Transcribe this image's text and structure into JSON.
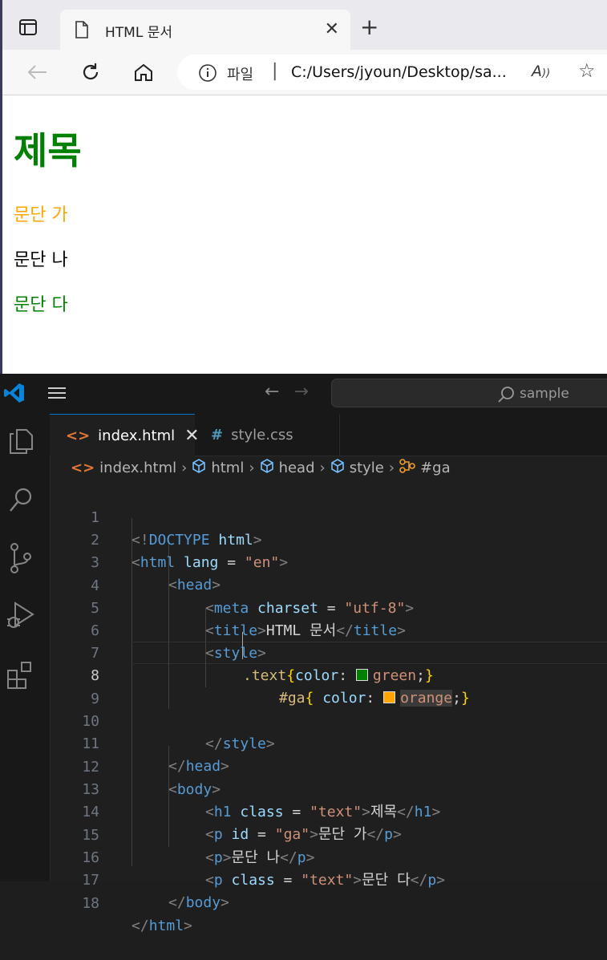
{
  "browser": {
    "tab_title": "HTML 문서",
    "address_label": "파일",
    "address_separator": "|",
    "address_url": "C:/Users/jyoun/Desktop/sa...",
    "read_aloud": "À",
    "page": {
      "h1": "제목",
      "p1": "문단 가",
      "p2": "문단 나",
      "p3": "문단 다"
    }
  },
  "vscode": {
    "search_placeholder": "sample",
    "tabs": [
      {
        "icon": "<>",
        "label": "index.html",
        "active": true
      },
      {
        "icon": "#",
        "label": "style.css",
        "active": false
      }
    ],
    "breadcrumb": [
      "index.html",
      "html",
      "head",
      "style",
      "#ga"
    ],
    "line_numbers": [
      "1",
      "2",
      "3",
      "4",
      "5",
      "6",
      "7",
      "8",
      "9",
      "10",
      "11",
      "12",
      "13",
      "14",
      "15",
      "16",
      "17",
      "18"
    ],
    "current_line": "8",
    "lines": {
      "l1": [
        "<!",
        "DOCTYPE",
        " ",
        "html",
        ">"
      ],
      "l2": [
        "<",
        "html",
        " ",
        "lang",
        " = ",
        "\"en\"",
        ">"
      ],
      "l3": [
        "<",
        "head",
        ">"
      ],
      "l4": [
        "<",
        "meta",
        " ",
        "charset",
        " = ",
        "\"utf-8\"",
        ">"
      ],
      "l5": [
        "<",
        "title",
        ">",
        "HTML 문서",
        "</",
        "title",
        ">"
      ],
      "l6": [
        "<",
        "style",
        ">"
      ],
      "l7": [
        ".text",
        "{",
        "color",
        ": ",
        "green",
        ";",
        "}"
      ],
      "l8": [
        "#ga",
        "{",
        " color",
        ": ",
        "orange",
        ";",
        "}"
      ],
      "l10": [
        "</",
        "style",
        ">"
      ],
      "l11": [
        "</",
        "head",
        ">"
      ],
      "l12": [
        "<",
        "body",
        ">"
      ],
      "l13": [
        "<",
        "h1",
        " ",
        "class",
        " = ",
        "\"text\"",
        ">",
        "제목",
        "</",
        "h1",
        ">"
      ],
      "l14": [
        "<",
        "p",
        " ",
        "id",
        " = ",
        "\"ga\"",
        ">",
        "문단 가",
        "</",
        "p",
        ">"
      ],
      "l15": [
        "<",
        "p",
        ">",
        "문단 나",
        "</",
        "p",
        ">"
      ],
      "l16": [
        "<",
        "p",
        " ",
        "class",
        " = ",
        "\"text\"",
        ">",
        "문단 다",
        "</",
        "p",
        ">"
      ],
      "l17": [
        "</",
        "body",
        ">"
      ],
      "l18": [
        "</",
        "html",
        ">"
      ]
    },
    "colors": {
      "green_swatch": "#008000",
      "orange_swatch": "#ffa500",
      "accent": "#0078d4"
    }
  }
}
